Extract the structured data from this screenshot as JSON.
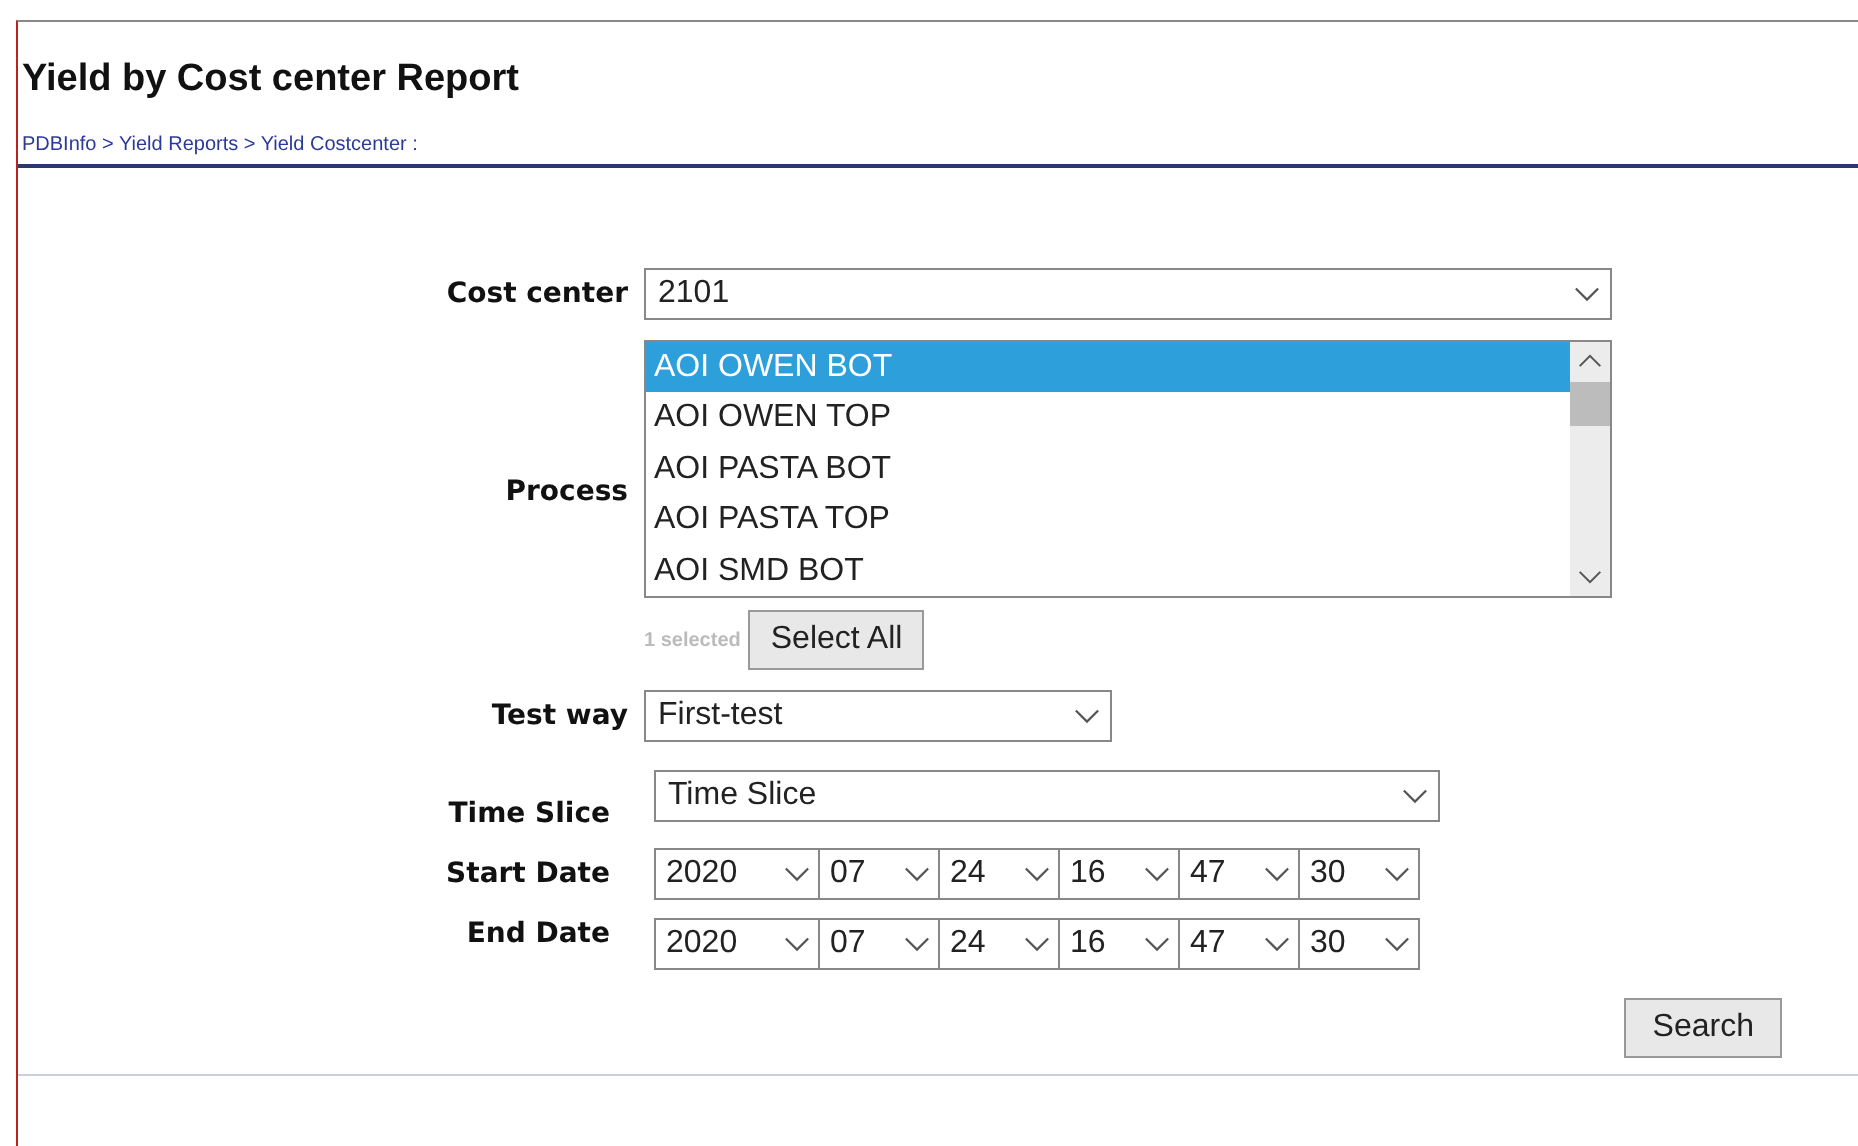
{
  "title": "Yield by Cost center Report",
  "breadcrumb": "PDBInfo > Yield Reports > Yield Costcenter :",
  "cost_center": {
    "label": "Cost center",
    "value": "2101"
  },
  "process": {
    "label": "Process",
    "options": [
      {
        "label": "AOI OWEN BOT",
        "selected": true
      },
      {
        "label": "AOI OWEN TOP",
        "selected": false
      },
      {
        "label": "AOI PASTA BOT",
        "selected": false
      },
      {
        "label": "AOI PASTA TOP",
        "selected": false
      },
      {
        "label": "AOI SMD BOT",
        "selected": false
      }
    ],
    "selection_count": "1 selected",
    "select_all": "Select All"
  },
  "test_way": {
    "label": "Test way",
    "value": "First-test"
  },
  "time_slice": {
    "label": "Time Slice",
    "value": "Time Slice"
  },
  "start_date": {
    "label": "Start Date",
    "parts": [
      "2020",
      "07",
      "24",
      "16",
      "47",
      "30"
    ]
  },
  "end_date": {
    "label": "End Date",
    "parts": [
      "2020",
      "07",
      "24",
      "16",
      "47",
      "30"
    ]
  },
  "search_button": "Search"
}
